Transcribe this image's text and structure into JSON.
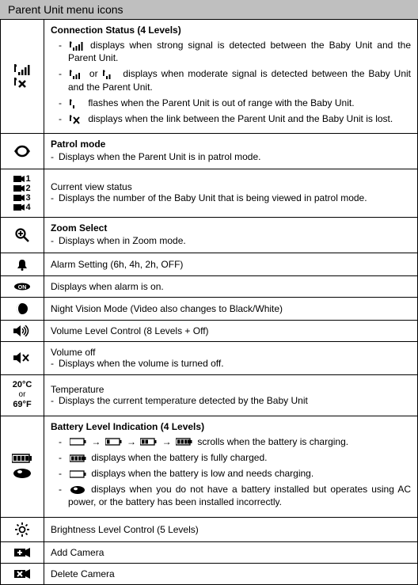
{
  "title": "Parent Unit menu icons",
  "rows": {
    "connection": {
      "heading": "Connection Status (4 Levels)",
      "bullets": [
        {
          "prefix_icon": "signal-4",
          "text": "displays when strong signal is detected between the Baby Unit and the Parent Unit."
        },
        {
          "prefix_icon": "signal-3",
          "mid_text": "or",
          "mid_icon": "signal-2",
          "text": "displays when moderate signal is detected between the Baby Unit and the Parent Unit."
        },
        {
          "prefix_icon": "signal-1",
          "text": "flashes when the Parent Unit is out of range with the Baby Unit."
        },
        {
          "prefix_icon": "signal-x",
          "text": "displays when the link between the Parent Unit and the Baby Unit is lost."
        }
      ]
    },
    "patrol": {
      "heading": "Patrol mode",
      "desc": "Displays when the Parent Unit is in patrol mode."
    },
    "current_view": {
      "heading": "Current view status",
      "desc": "Displays the number of the Baby Unit that is being viewed in patrol mode.",
      "cameras": [
        "1",
        "2",
        "3",
        "4"
      ]
    },
    "zoom": {
      "heading": "Zoom Select",
      "desc": "Displays when in Zoom mode."
    },
    "alarm_setting": {
      "heading": "Alarm Setting (6h, 4h, 2h, OFF)"
    },
    "alarm_on": {
      "heading": "Displays when alarm is on."
    },
    "night_vision": {
      "heading": "Night Vision Mode (Video also changes to Black/White)"
    },
    "volume": {
      "heading": "Volume Level Control (8 Levels + Off)"
    },
    "volume_off": {
      "heading": "Volume off",
      "desc": "Displays when the volume is turned off."
    },
    "temperature": {
      "label1": "20°C",
      "label_or": "or",
      "label2": "69°F",
      "heading": "Temperature",
      "desc": "Displays the current temperature detected by the Baby Unit"
    },
    "battery": {
      "heading": "Battery Level Indication (4 Levels)",
      "bullets": [
        {
          "arrow_sequence": true,
          "text": "scrolls when the battery is charging."
        },
        {
          "prefix_icon": "battery-full",
          "text": "displays when the battery is fully charged."
        },
        {
          "prefix_icon": "battery-empty",
          "text": "displays when the battery is low and needs charging."
        },
        {
          "prefix_icon": "battery-blob",
          "text": "displays when you do not have a battery installed but operates using AC power, or the battery has been installed incorrectly."
        }
      ]
    },
    "brightness": {
      "heading": "Brightness Level Control (5 Levels)"
    },
    "add_camera": {
      "heading": "Add Camera"
    },
    "delete_camera": {
      "heading": "Delete Camera"
    }
  }
}
